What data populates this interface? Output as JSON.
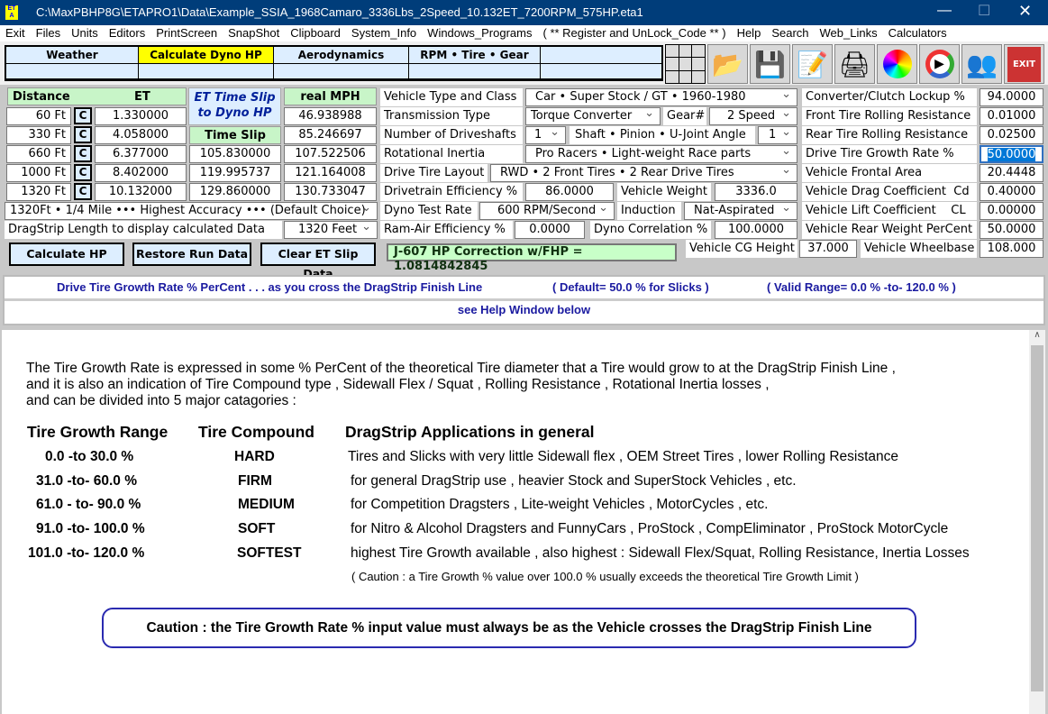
{
  "window": {
    "title": "C:\\MaxPBHP8G\\ETAPRO1\\Data\\Example_SSIA_1968Camaro_3336Lbs_2Speed_10.132ET_7200RPM_575HP.eta1",
    "app_icon": "ET A"
  },
  "menu": [
    "Exit",
    "Files",
    "Units",
    "Editors",
    "PrintScreen",
    "SnapShot",
    "Clipboard",
    "System_Info",
    "Windows_Programs",
    "( ** Register and UnLock_Code ** )",
    "Help",
    "Search",
    "Web_Links",
    "Calculators"
  ],
  "tabs": [
    "Weather",
    "Calculate Dyno HP",
    "Aerodynamics",
    "RPM  •  Tire  •  Gear",
    ""
  ],
  "active_tab_color": "#ffff00",
  "toolbar_icons": [
    "open-folder-icon",
    "save-disk-icon",
    "notepad-edit-icon",
    "printer-icon",
    "color-wheel-icon",
    "media-play-icon",
    "users-icon",
    "exit-door-icon"
  ],
  "left": {
    "distance_header": "Distance",
    "et_header": "ET",
    "slip_title": "ET Time Slip to Dyno HP",
    "real_mph_header": "real  MPH",
    "slip_mph_header": "Time Slip MPH",
    "c_label": "C",
    "rows": [
      {
        "distance": "60 Ft",
        "et": "1.330000",
        "slip_mph": "",
        "real_mph": "46.938988"
      },
      {
        "distance": "330 Ft",
        "et": "4.058000",
        "slip_mph": "",
        "real_mph": "85.246697"
      },
      {
        "distance": "660 Ft",
        "et": "6.377000",
        "slip_mph": "105.830000",
        "real_mph": "107.522506"
      },
      {
        "distance": "1000 Ft",
        "et": "8.402000",
        "slip_mph": "119.995737",
        "real_mph": "121.164008"
      },
      {
        "distance": "1320 Ft",
        "et": "10.132000",
        "slip_mph": "129.860000",
        "real_mph": "130.733047"
      }
    ],
    "accuracy_select": "1320Ft • 1/4 Mile ••• Highest Accuracy ••• (Default Choice)",
    "length_label": "DragStrip Length to display calculated Data",
    "length_select": "1320 Feet",
    "calc_button": "Calculate  HP",
    "restore_button": "Restore Run Data",
    "clear_button": "Clear ET Slip Data"
  },
  "middle": {
    "vehicle_type_label": "Vehicle Type and Class",
    "vehicle_type": "Car  •  Super Stock / GT  •  1960-1980",
    "trans_label": "Transmission Type",
    "trans": "Torque Converter",
    "gear_label": "Gear#",
    "gear": "2  Speed",
    "driveshafts_label": "Number of Driveshafts",
    "driveshafts": "1",
    "angle_label": "Shaft • Pinion • U-Joint Angle",
    "angle": "1",
    "inertia_label": "Rotational Inertia",
    "inertia": "Pro Racers  •  Light-weight Race parts",
    "layout_label": "Drive Tire Layout",
    "layout": "RWD • 2  Front Tires  •  2  Rear Drive Tires",
    "dt_eff_label": "Drivetrain Efficiency %",
    "dt_eff": "86.0000",
    "weight_label": "Vehicle Weight",
    "weight": "3336.0",
    "dyno_rate_label": "Dyno Test Rate",
    "dyno_rate": "600 RPM/Second",
    "induction_label": "Induction",
    "induction": "Nat-Aspirated",
    "ram_label": "Ram-Air Efficiency %",
    "ram": "0.0000",
    "corr_label": "Dyno Correlation %",
    "corr": "100.0000",
    "j607": "J-607 HP Correction w/FHP = 1.0814842845",
    "cg_label": "Vehicle CG Height",
    "cg": "37.000"
  },
  "right": [
    {
      "label": "Converter/Clutch Lockup %",
      "value": "94.0000"
    },
    {
      "label": "Front Tire Rolling Resistance",
      "value": "0.01000"
    },
    {
      "label": "Rear Tire Rolling Resistance",
      "value": "0.02500"
    },
    {
      "label": "Drive Tire Growth Rate %",
      "value": "50.0000"
    },
    {
      "label": "Vehicle Frontal Area",
      "value": "20.4448"
    },
    {
      "label": "Vehicle Drag Coefficient  Cd",
      "value": "0.40000"
    },
    {
      "label": "Vehicle Lift Coefficient    CL",
      "value": "0.00000"
    },
    {
      "label": "Vehicle Rear Weight PerCent",
      "value": "50.0000"
    }
  ],
  "wheelbase_label": "Vehicle Wheelbase",
  "wheelbase": "108.000",
  "info": {
    "line1a": "Drive Tire Growth Rate % PerCent . . . as you cross the DragStrip Finish Line",
    "line1b": "( Default= 50.0 % for Slicks )",
    "line1c": "( Valid Range=  0.0 % -to- 120.0 % )",
    "line2": "see Help Window below"
  },
  "help": {
    "intro": [
      "The Tire Growth Rate is expressed in some % PerCent of the theoretical Tire diameter that a Tire would grow to at the DragStrip Finish Line ,",
      "and it is also an indication of Tire Compound type , Sidewall Flex / Squat , Rolling Resistance , Rotational Inertia losses ,",
      "and can be divided into 5 major catagories :"
    ],
    "headers": [
      "Tire Growth Range",
      "Tire Compound",
      "DragStrip Applications in general"
    ],
    "rows": [
      [
        "0.0  -to   30.0 %",
        "HARD",
        "Tires and Slicks with very little Sidewall flex , OEM Street Tires , lower Rolling Resistance"
      ],
      [
        "31.0  -to-  60.0 %",
        "FIRM",
        "for general DragStrip use , heavier Stock and SuperStock Vehicles , etc."
      ],
      [
        "61.0 - to-  90.0 %",
        "MEDIUM",
        "for Competition Dragsters , Lite-weight Vehicles , MotorCycles , etc."
      ],
      [
        "91.0 -to- 100.0 %",
        "SOFT",
        "for Nitro & Alcohol Dragsters and FunnyCars , ProStock , CompEliminator , ProStock MotorCycle"
      ],
      [
        "101.0 -to-  120.0 %",
        "SOFTEST",
        "highest Tire Growth available , also highest : Sidewall Flex/Squat, Rolling Resistance, Inertia Losses"
      ]
    ],
    "note": "( Caution :    a Tire Growth % value over 100.0 % usually exceeds the theoretical Tire Growth Limit )",
    "caution": "Caution :   the Tire Growth Rate % input value must always be as the Vehicle crosses the DragStrip Finish Line"
  }
}
